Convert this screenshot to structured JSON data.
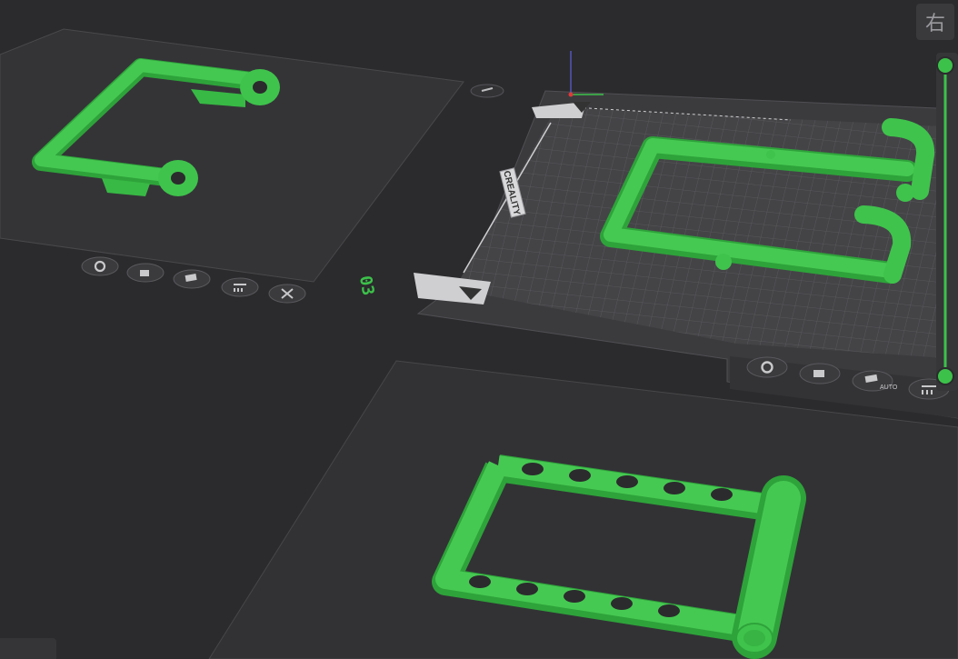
{
  "view_button": {
    "label": "右"
  },
  "plates": {
    "plate_top_left": {
      "toolbar_icons": [
        "gear-icon",
        "lock-icon",
        "auto-arrange-icon",
        "plate-settings-icon",
        "close-icon"
      ]
    },
    "plate_main": {
      "label": "03",
      "brand": "CREALITY",
      "auto_label": "AUTO",
      "toolbar_icons": [
        "gear-icon",
        "lock-icon",
        "auto-arrange-icon",
        "plate-settings-icon"
      ]
    },
    "plate_bottom": {}
  },
  "layer_slider": {
    "top_value": 1.0,
    "bottom_value": 0.0
  },
  "colors": {
    "background": "#2b2b2d",
    "plate": "#3d3d40",
    "grid": "#5a5a5e",
    "model_green": "#3ec44b",
    "slider_green": "#3cc24a"
  }
}
